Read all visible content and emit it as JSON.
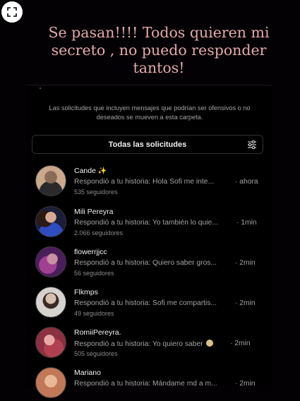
{
  "caption": "Se pasan!!!! Todos quieren mi secreto , no puedo responder tantos!",
  "info_text": "Las solicitudes que incluyen mensajes que podrían ser ofensivos o no deseados se mueven a esta carpeta.",
  "filter_label": "Todas las solicitudes",
  "requests": [
    {
      "name": "Cande",
      "badge": "✨",
      "message": "Respondió a tu historia: Hola Sofi me inte...",
      "time": "· ahora",
      "followers": "535 seguidores",
      "avatar_color": "#caa88c"
    },
    {
      "name": "Mili Pereyra",
      "message": "Respondió a tu historia: Yo también lo quie...",
      "time": "· 1min",
      "followers": "2.066 seguidores",
      "avatar_color": "#3a4c8a"
    },
    {
      "name": "flowerrjjcc",
      "message": "Respondió a tu historia: Quiero saber gros...",
      "time": "· 2min",
      "followers": "56 seguidores",
      "avatar_color": "#7a3a86"
    },
    {
      "name": "Flkmps",
      "message": "Respondió a tu historia: Sofi me compartis...",
      "time": "· 2min",
      "followers": "49 seguidores",
      "avatar_color": "#b8b0ac"
    },
    {
      "name": "RomiiPereyra.",
      "message": "Respondió a tu historia: Yo quiero saber",
      "emoji": "😕",
      "time": "· 2min",
      "followers": "505 seguidores",
      "avatar_color": "#c0707e"
    },
    {
      "name": "Mariano",
      "message": "Respondió a tu historia: Mándame md a m...",
      "time": "· 2min",
      "followers": "",
      "avatar_color": "#d9a083"
    }
  ]
}
